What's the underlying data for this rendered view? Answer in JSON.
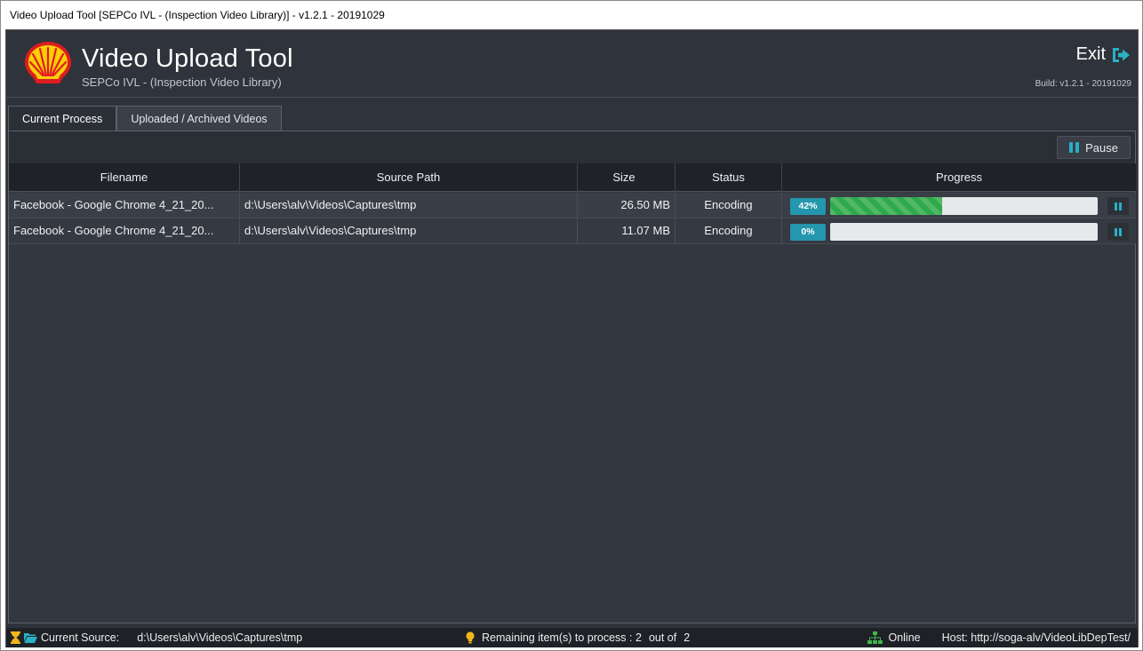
{
  "window": {
    "title": "Video Upload Tool [SEPCo IVL - (Inspection Video Library)] - v1.2.1 - 20191029"
  },
  "header": {
    "logo_icon": "shell-logo-icon",
    "title": "Video Upload Tool",
    "subtitle": "SEPCo IVL - (Inspection Video Library)",
    "exit_label": "Exit",
    "exit_icon": "sign-out-icon",
    "build": "Build: v1.2.1 - 20191029"
  },
  "tabs": [
    {
      "label": "Current Process",
      "active": true
    },
    {
      "label": "Uploaded / Archived Videos",
      "active": false
    }
  ],
  "toolbar": {
    "pause_label": "Pause",
    "pause_icon": "pause-icon"
  },
  "table": {
    "columns": [
      "Filename",
      "Source Path",
      "Size",
      "Status",
      "Progress"
    ],
    "rows": [
      {
        "filename": "Facebook - Google Chrome 4_21_20...",
        "path": "d:\\Users\\alv\\Videos\\Captures\\tmp",
        "size": "26.50 MB",
        "status": "Encoding",
        "progress_label": "42%",
        "progress": 0.42
      },
      {
        "filename": "Facebook - Google Chrome 4_21_20...",
        "path": "d:\\Users\\alv\\Videos\\Captures\\tmp",
        "size": "11.07 MB",
        "status": "Encoding",
        "progress_label": "0%",
        "progress": 0
      }
    ]
  },
  "statusbar": {
    "source_label": "Current Source:",
    "source_value": "d:\\Users\\alv\\Videos\\Captures\\tmp",
    "remaining_label": "Remaining item(s) to process : 2",
    "out_of_label": "out of",
    "out_of_value": "2",
    "online_label": "Online",
    "host": "Host: http://soga-alv/VideoLibDepTest/"
  },
  "colors": {
    "accent": "#2496ad",
    "progress": "#2eaa4a",
    "background": "#2f333b"
  }
}
